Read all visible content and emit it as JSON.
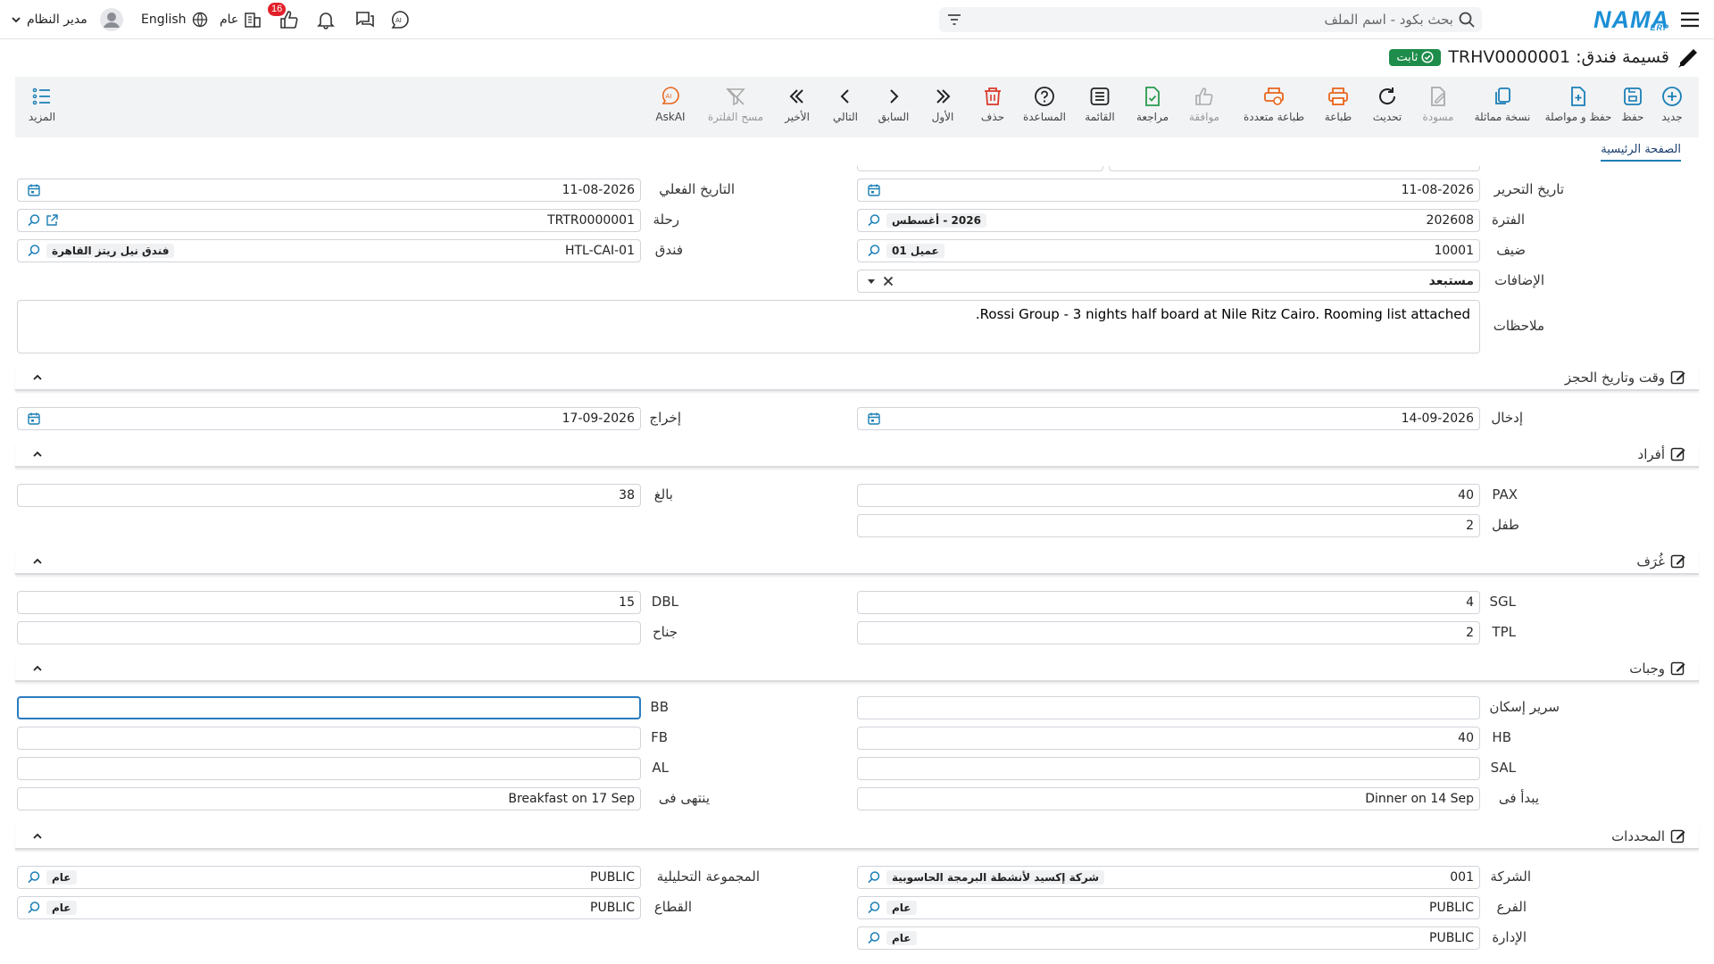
{
  "topbar": {
    "logo": "NAMA",
    "logo_sub": "ERP",
    "search_placeholder": "بحث بكود - اسم الملف",
    "user_name": "مدير النظام",
    "language": "English",
    "branch": "عام",
    "notifications_count": "16"
  },
  "title": {
    "text": "قسيمة فندق: TRHV0000001",
    "status": "ثابت"
  },
  "toolbar": {
    "new": "جديد",
    "save": "حفظ",
    "save_continue": "حفظ و مواصلة",
    "duplicate": "نسخة مماثلة",
    "draft": "مسودة",
    "refresh": "تحديث",
    "print": "طباعة",
    "multi_print": "طباعة متعددة",
    "approve": "موافقة",
    "review": "مراجعة",
    "list": "القائمة",
    "help": "المساعدة",
    "delete": "حذف",
    "first": "الأول",
    "previous": "السابق",
    "next": "التالي",
    "last": "الأخير",
    "clear_filter": "مسح الفلترة",
    "askai": "AskAI",
    "more": "المزيد"
  },
  "tabs": {
    "main": "الصفحة الرئيسية"
  },
  "header_fields": {
    "edit_date_label": "تاريخ التحرير",
    "edit_date": "11-08-2026",
    "actual_date_label": "التاريخ الفعلي",
    "actual_date": "11-08-2026",
    "period_label": "الفترة",
    "period_code": "202608",
    "period_name": "2026 - أغسطس",
    "trip_label": "رحلة",
    "trip": "TRTR0000001",
    "guest_label": "ضيف",
    "guest_code": "10001",
    "guest_name": "عميل 01",
    "hotel_label": "فندق",
    "hotel_code": "HTL-CAI-01",
    "hotel_name": "فندق نيل ريتز القاهرة",
    "additions_label": "الإضافات",
    "additions_value": "مستبعد",
    "notes_label": "ملاحظات",
    "notes_value": "Rossi Group - 3 nights half board at Nile Ritz Cairo. Rooming list attached."
  },
  "booking": {
    "section_title": "وقت وتاريخ الحجز",
    "checkin_label": "إدخال",
    "checkin": "14-09-2026",
    "checkout_label": "إخراج",
    "checkout": "17-09-2026"
  },
  "persons": {
    "section_title": "أفراد",
    "pax_label": "PAX",
    "pax": "40",
    "adult_label": "بالغ",
    "adult": "38",
    "child_label": "طفل",
    "child": "2"
  },
  "rooms": {
    "section_title": "غُرَف",
    "sgl_label": "SGL",
    "sgl": "4",
    "dbl_label": "DBL",
    "dbl": "15",
    "tpl_label": "TPL",
    "tpl": "2",
    "suite_label": "جناح",
    "suite": ""
  },
  "meals": {
    "section_title": "وجبات",
    "housing_bed_label": "سرير إسكان",
    "housing_bed": "",
    "bb_label": "BB",
    "bb": "",
    "hb_label": "HB",
    "hb": "40",
    "fb_label": "FB",
    "fb": "",
    "sal_label": "SAL",
    "sal": "",
    "al_label": "AL",
    "al": "",
    "starts_label": "يبدأ فى",
    "starts": "Dinner on 14 Sep",
    "ends_label": "ينتهى فى",
    "ends": "Breakfast on 17 Sep"
  },
  "dimensions": {
    "section_title": "المحددات",
    "company_label": "الشركة",
    "company_code": "001",
    "company_name": "شركة إكسيد لأنشطة البرمجة الحاسوبية",
    "analysis_label": "المجموعة التحليلية",
    "analysis_code": "PUBLIC",
    "analysis_name": "عام",
    "branch_label": "الفرع",
    "branch_code": "PUBLIC",
    "branch_name": "عام",
    "sector_label": "القطاع",
    "sector_code": "PUBLIC",
    "sector_name": "عام",
    "department_label": "الإدارة",
    "department_code": "PUBLIC",
    "department_name": "عام"
  },
  "colors": {
    "accent": "#1b8fd6",
    "status": "#1e8c4a",
    "badge": "#e2202a"
  }
}
